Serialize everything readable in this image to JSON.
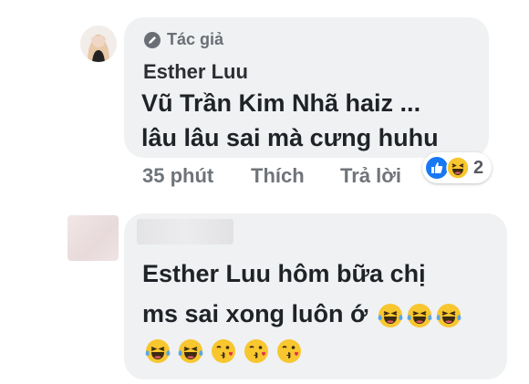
{
  "comment1": {
    "author_badge": "Tác giả",
    "author_name": "Esther Luu",
    "mention": "Vũ Trần Kim Nhã",
    "text_after_mention": "  haiz ...",
    "text_line2": "lâu lâu sai mà cưng huhu",
    "time": "35 phút",
    "like_label": "Thích",
    "reply_label": "Trả lời",
    "reactions": {
      "icons": [
        "like-icon",
        "haha-icon"
      ],
      "count": "2"
    }
  },
  "comment2": {
    "mention": "Esther Luu",
    "line1_rest": " hôm bữa chị",
    "line2": "ms sai xong luôn ớ",
    "line2_emojis": [
      "crying-laughing-emoji",
      "crying-laughing-emoji",
      "crying-laughing-emoji"
    ],
    "line3_emojis": [
      "crying-laughing-emoji",
      "crying-laughing-emoji",
      "kiss-emoji",
      "kiss-emoji",
      "kiss-emoji"
    ]
  },
  "colors": {
    "bubble": "#eff1f3",
    "text": "#1f2226",
    "meta": "#6f747a",
    "like_blue": "#1877f2",
    "emoji_yellow": "#f8c62e"
  }
}
